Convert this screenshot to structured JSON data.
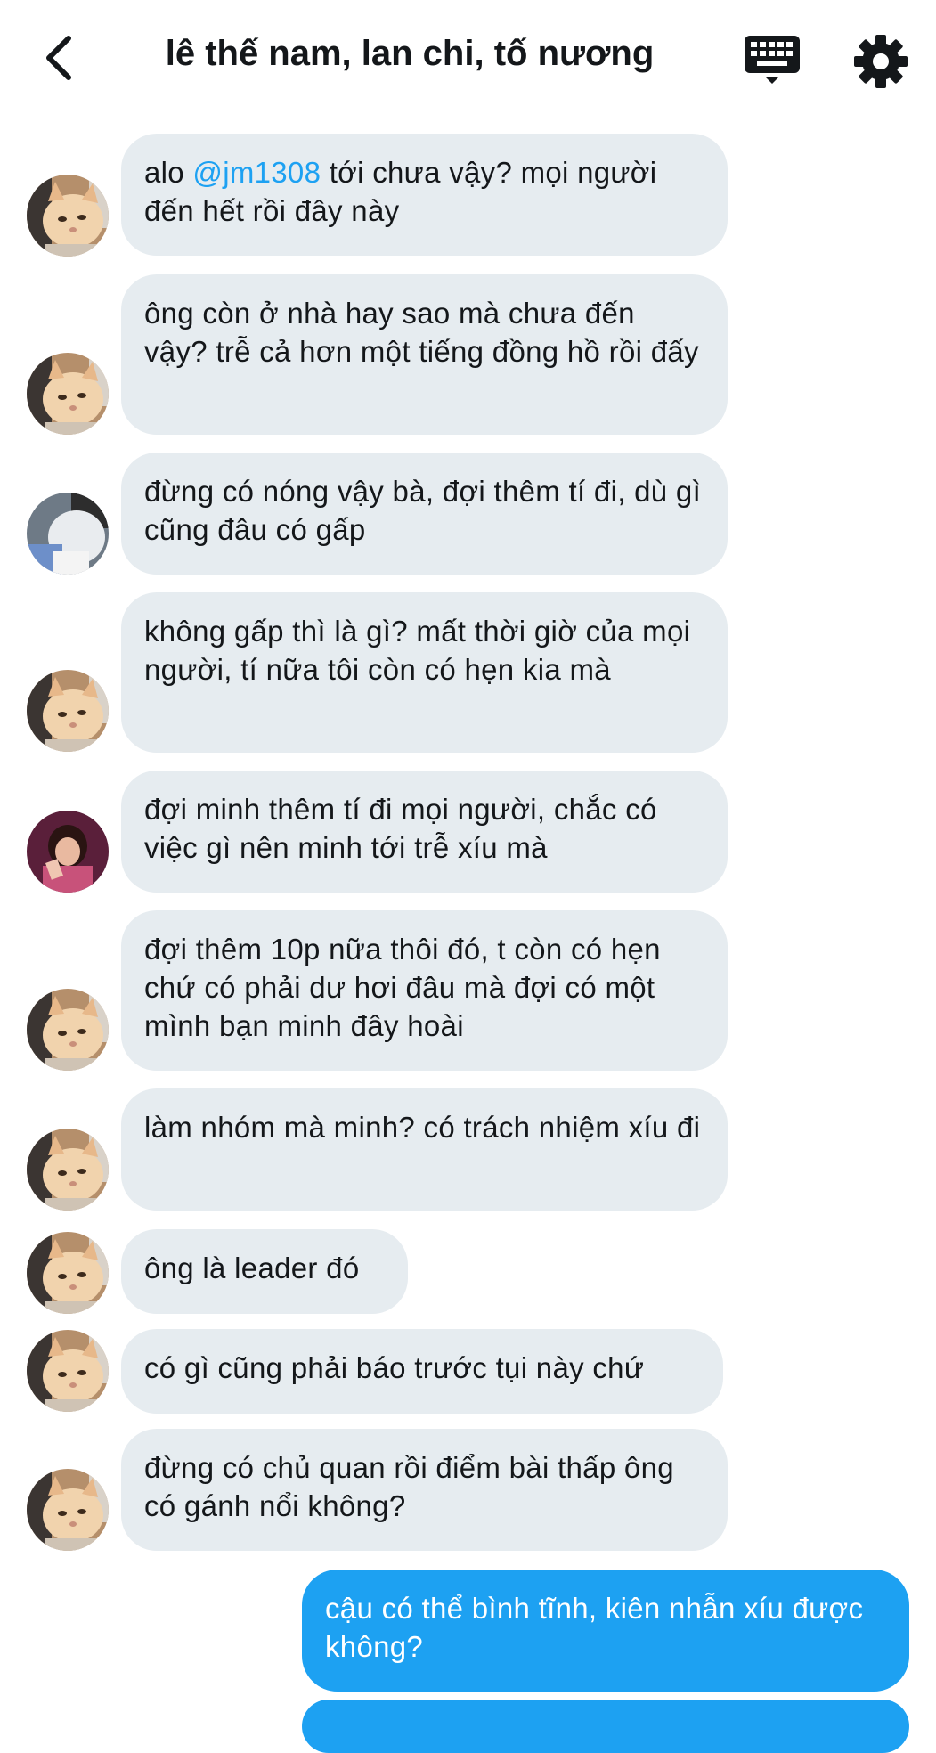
{
  "header": {
    "title": "lê thế nam, lan chi, tố nương",
    "back_icon": "chevron-left-icon",
    "keyboard_icon": "keyboard-icon",
    "settings_icon": "gear-icon"
  },
  "colors": {
    "bubble_incoming": "#e6ecf0",
    "bubble_outgoing": "#1da1f2",
    "mention": "#1da1f2",
    "text": "#14171a"
  },
  "messages": [
    {
      "sender": "cat-avatar",
      "mention": "@jm1308",
      "pre": "alo ",
      "post": " tới chưa vậy? mọi người đến hết rồi đây này"
    },
    {
      "sender": "cat-avatar",
      "text": "ông còn ở nhà hay sao mà chưa đến vậy? trễ cả hơn một tiếng đồng hồ rồi đấy"
    },
    {
      "sender": "person-avatar",
      "text": "đừng có nóng vậy bà, đợi thêm tí đi, dù gì cũng đâu có gấp"
    },
    {
      "sender": "cat-avatar",
      "text": "không gấp thì là gì? mất thời giờ của mọi người, tí nữa tôi còn có hẹn kia mà"
    },
    {
      "sender": "girl-avatar",
      "text": "đợi minh thêm tí đi mọi người, chắc có việc gì nên minh tới trễ xíu mà"
    },
    {
      "sender": "cat-avatar",
      "text": "đợi thêm 10p nữa thôi đó, t còn có hẹn chứ có phải dư hơi đâu mà đợi có một mình bạn minh đây hoài"
    },
    {
      "sender": "cat-avatar",
      "text": "làm nhóm mà minh? có trách nhiệm xíu đi"
    },
    {
      "sender": "cat-avatar",
      "text": "ông là leader đó"
    },
    {
      "sender": "cat-avatar",
      "text": "có gì cũng phải báo trước tụi này chứ"
    },
    {
      "sender": "cat-avatar",
      "text": "đừng có chủ quan rồi điểm bài thấp ông có gánh nổi không?"
    },
    {
      "sender": "me",
      "text": "cậu có thể bình tĩnh, kiên nhẫn xíu được không?"
    },
    {
      "sender": "me",
      "text": ""
    }
  ]
}
